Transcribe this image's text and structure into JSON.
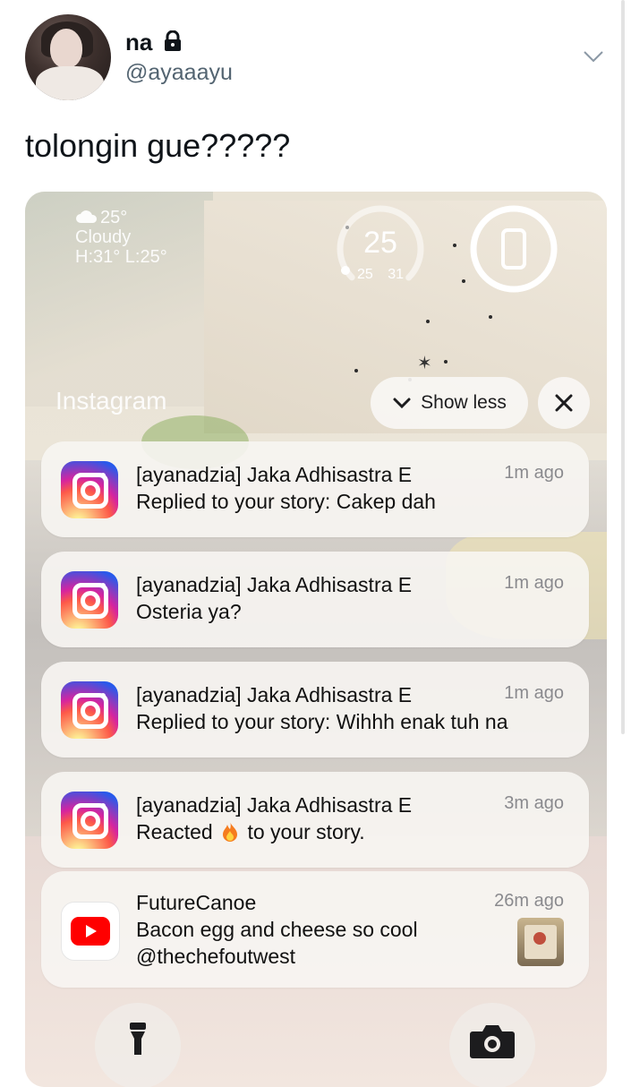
{
  "tweet": {
    "display_name": "na",
    "handle": "@ayaaayu",
    "text": "tolongin gue?????"
  },
  "screenshot": {
    "weather": {
      "temp": "25°",
      "condition": "Cloudy",
      "high_low": "H:31° L:25°"
    },
    "temp_widget": {
      "current": "25",
      "range": "25 31",
      "level_fraction": 0.0
    },
    "app_label": "Instagram",
    "show_less_label": "Show less",
    "notifications": [
      {
        "app": "instagram",
        "title": "[ayanadzia] Jaka Adhisastra E",
        "body": "Replied to your story: Cakep dah",
        "time": "1m ago"
      },
      {
        "app": "instagram",
        "title": "[ayanadzia] Jaka Adhisastra E",
        "body": "Osteria ya?",
        "time": "1m ago"
      },
      {
        "app": "instagram",
        "title": "[ayanadzia] Jaka Adhisastra E",
        "body": "Replied to your story: Wihhh enak tuh na",
        "time": "1m ago"
      },
      {
        "app": "instagram",
        "title": "[ayanadzia] Jaka Adhisastra E",
        "body_before": "Reacted",
        "body_after": "to your story.",
        "time": "3m ago"
      },
      {
        "app": "youtube",
        "title": "FutureCanoe",
        "body_line1": "Bacon egg and cheese so cool",
        "body_line2": "@thechefoutwest",
        "time": "26m ago"
      }
    ],
    "icons": {
      "lock": "lock-icon",
      "chevron": "chevron-down-icon",
      "close": "close-icon",
      "flashlight": "flashlight-icon",
      "camera": "camera-icon",
      "battery": "phone-battery-icon"
    }
  }
}
